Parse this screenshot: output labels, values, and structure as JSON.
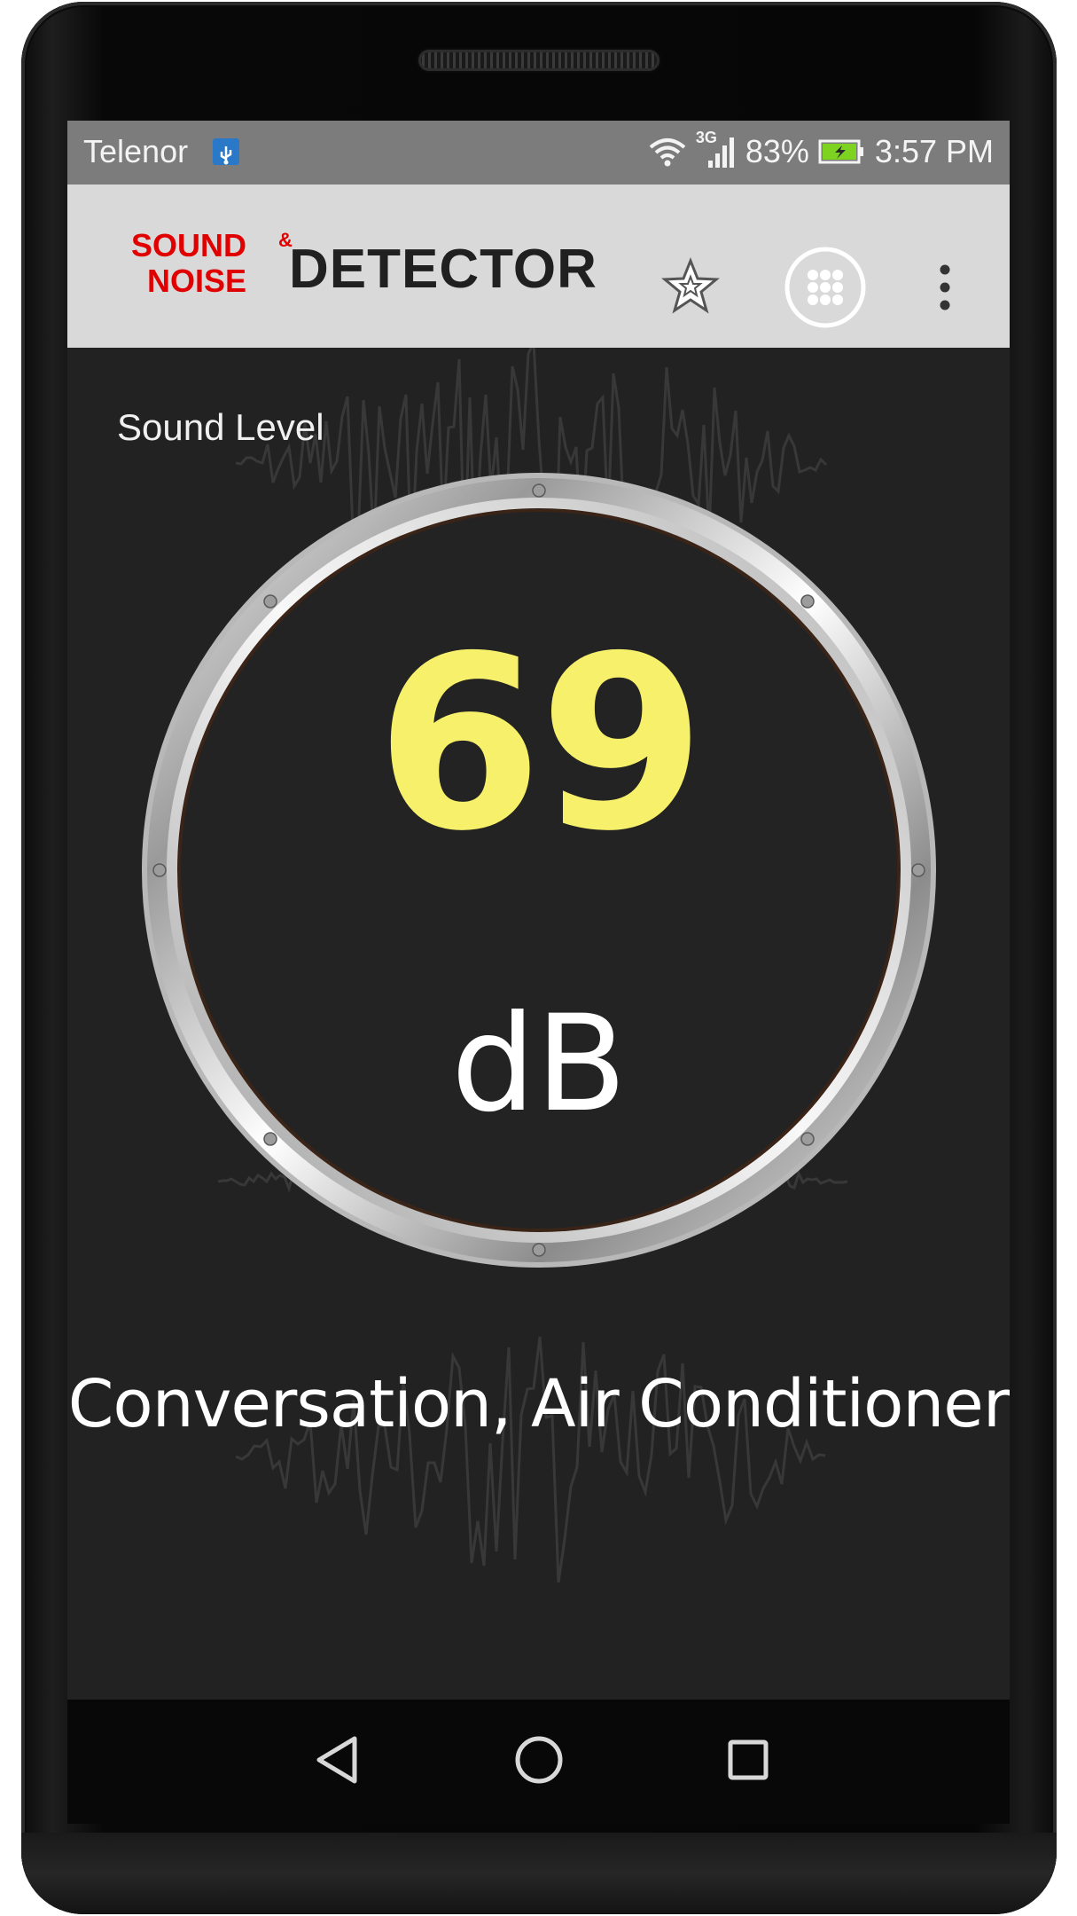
{
  "status_bar": {
    "carrier": "Telenor",
    "network_type": "3G",
    "battery_percent": "83%",
    "time": "3:57 PM",
    "icons": [
      "usb-debug-icon",
      "wifi-icon",
      "signal-icon",
      "battery-charging-icon"
    ]
  },
  "app_bar": {
    "logo": {
      "sound": "SOUND",
      "ampersand": "&",
      "noise": "NOISE",
      "detector": "DETECTOR"
    },
    "actions": [
      "star-icon",
      "apps-grid-icon",
      "overflow-menu-icon"
    ]
  },
  "meter": {
    "label": "Sound Level",
    "value": "69",
    "unit": "dB",
    "classification": "Conversation, Air Conditioner"
  },
  "nav_bar": {
    "buttons": [
      "back-icon",
      "home-icon",
      "recent-apps-icon"
    ]
  },
  "colors": {
    "reading": "#f7f06a",
    "logo_accent": "#e00000",
    "screen_bg": "#222222",
    "app_bar_bg": "#d9d9d9",
    "status_bar_bg": "#7c7c7c"
  }
}
